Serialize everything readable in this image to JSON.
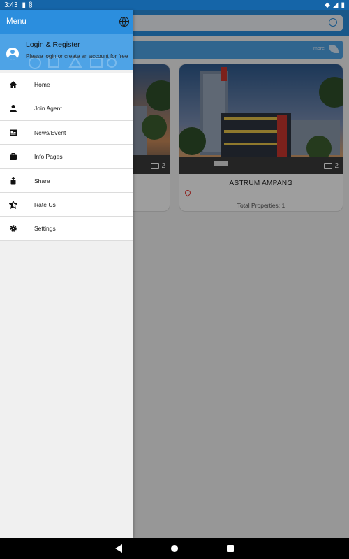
{
  "status_bar": {
    "time": "3:43"
  },
  "drawer": {
    "title": "Menu",
    "login": {
      "title": "Login & Register",
      "subtitle": "Please login or create an account for free"
    },
    "items": [
      {
        "label": "Home",
        "icon": "home-icon"
      },
      {
        "label": "Join Agent",
        "icon": "person-icon"
      },
      {
        "label": "News/Event",
        "icon": "newspaper-icon"
      },
      {
        "label": "Info Pages",
        "icon": "briefcase-icon"
      },
      {
        "label": "Share",
        "icon": "share-icon"
      },
      {
        "label": "Rate Us",
        "icon": "star-icon"
      },
      {
        "label": "Settings",
        "icon": "gear-icon"
      }
    ]
  },
  "background": {
    "banner_more": "more",
    "cards": [
      {
        "title": "",
        "photo_count": "2",
        "total": ""
      },
      {
        "title": "ASTRUM AMPANG",
        "photo_count": "2",
        "total": "Total Properties: 1"
      }
    ]
  },
  "colors": {
    "primary": "#2b8ede",
    "primary_light": "#4ea3e6",
    "status_bar": "#1565a8",
    "pin": "#e53935"
  }
}
